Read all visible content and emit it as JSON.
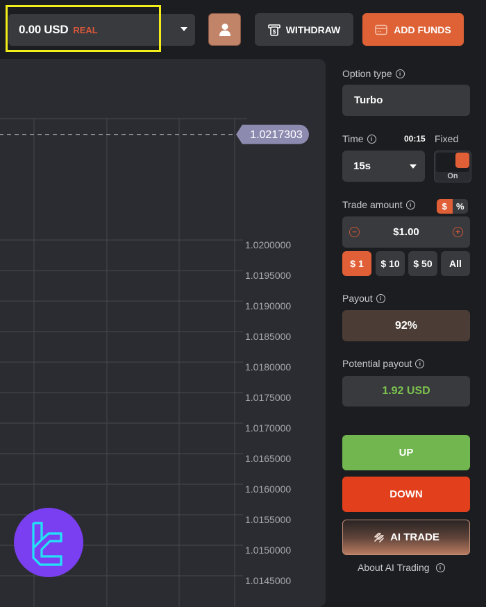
{
  "header": {
    "balance": {
      "amount": "0.00 USD",
      "mode": "REAL"
    },
    "withdraw_label": "WITHDRAW",
    "add_funds_label": "ADD FUNDS",
    "icons": {
      "profile": "user-icon",
      "withdraw": "atm-cash-icon",
      "add_funds": "wallet-card-icon",
      "dropdown": "caret-down-icon"
    },
    "highlight_color": "#f2ee1b"
  },
  "chart": {
    "current_price": "1.0217303"
  },
  "chart_data": {
    "type": "line",
    "title": "",
    "xlabel": "",
    "ylabel": "",
    "y_tick_labels": [
      "1.0200000",
      "1.0195000",
      "1.0190000",
      "1.0185000",
      "1.0180000",
      "1.0175000",
      "1.0170000",
      "1.0165000",
      "1.0160000",
      "1.0155000",
      "1.0150000",
      "1.0145000"
    ],
    "y_ticks": [
      1.02,
      1.0195,
      1.019,
      1.0185,
      1.018,
      1.0175,
      1.017,
      1.0165,
      1.016,
      1.0155,
      1.015,
      1.0145
    ],
    "ylim": [
      1.01435,
      1.02199
    ],
    "current_price_line": 1.0217303,
    "grid": true,
    "vertical_gridlines": 4,
    "series": []
  },
  "sidebar": {
    "option_type": {
      "label": "Option type",
      "value": "Turbo"
    },
    "time": {
      "label": "Time",
      "countdown": "00:15",
      "value": "15s"
    },
    "fixed": {
      "label": "Fixed",
      "state": "On"
    },
    "trade_amount": {
      "label": "Trade amount",
      "units": [
        "$",
        "%"
      ],
      "active_unit": "$",
      "value": "$1.00",
      "presets": [
        "$ 1",
        "$ 10",
        "$ 50",
        "All"
      ]
    },
    "payout": {
      "label": "Payout",
      "value": "92%"
    },
    "potential_payout": {
      "label": "Potential payout",
      "value": "1.92 USD"
    },
    "up_label": "UP",
    "down_label": "DOWN",
    "ai_trade_label": "AI TRADE",
    "about_ai_label": "About AI Trading"
  },
  "colors": {
    "accent": "#e05f36",
    "up": "#72b64f",
    "down": "#e2401d",
    "profit": "#7cc24e",
    "price_tag": "#8d8ab0",
    "logo_bg": "#7b3ff2",
    "logo_fg": "#22e3f5"
  }
}
